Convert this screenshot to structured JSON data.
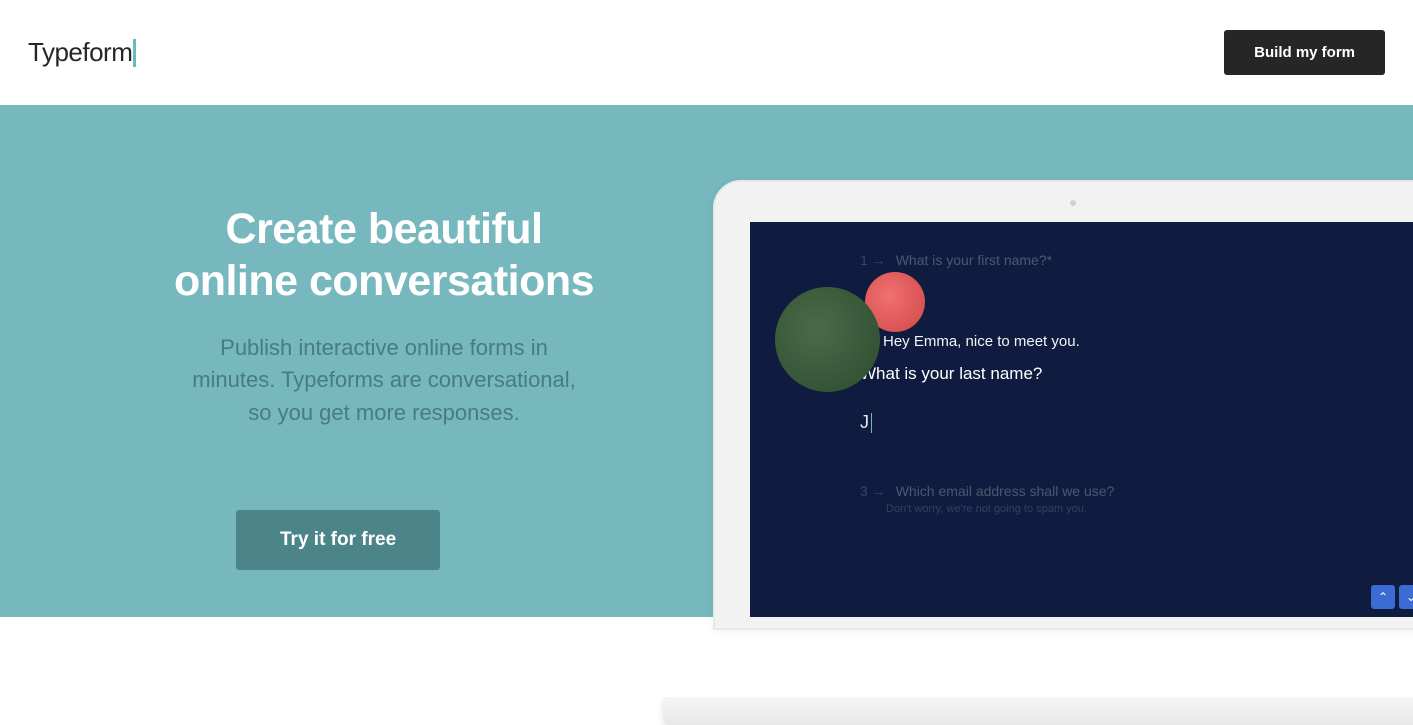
{
  "header": {
    "logo_text": "Typeform",
    "build_button": "Build my form"
  },
  "hero": {
    "title_line1": "Create beautiful",
    "title_line2": "online conversations",
    "subtitle": "Publish interactive online forms in minutes. Typeforms are conversational, so you get more responses.",
    "try_button": "Try it for free"
  },
  "form_preview": {
    "question1": {
      "number": "1 →",
      "text": "What is your first name?*"
    },
    "question2": {
      "arrow": "→",
      "greeting": "Hey Emma, nice to meet you.",
      "main": "What is your last name?",
      "input_value": "J"
    },
    "question3": {
      "number": "3 →",
      "text": "Which email address shall we use?",
      "hint": "Don't worry, we're not going to spam you."
    }
  },
  "colors": {
    "hero_bg": "#76b8bd",
    "accent": "#6bb9bd",
    "button_dark": "#262627",
    "button_teal": "#4c8589",
    "screen_bg": "#0f1c3f"
  }
}
